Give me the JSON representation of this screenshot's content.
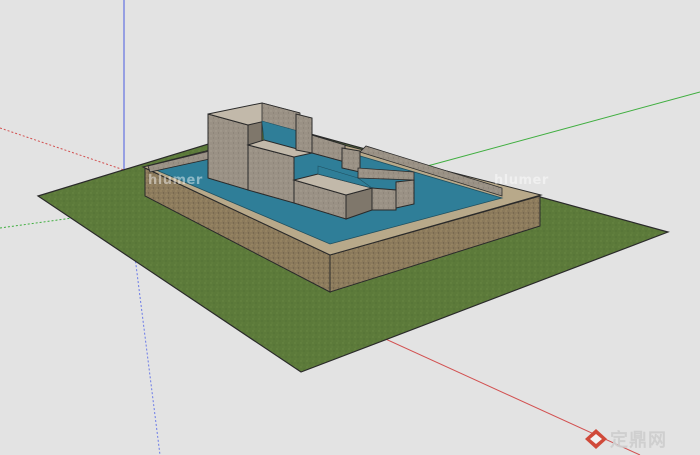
{
  "viewport": {
    "background": "#e3e3e3",
    "axes": {
      "blue": "#4a5be0",
      "red": "#d25050",
      "green": "#3fae3f"
    }
  },
  "model": {
    "grass_color": "#5c7a3a",
    "wall_color": "#8b7a5c",
    "water_color": "#2f7e98",
    "block_color": "#9a9185"
  },
  "watermarks": {
    "left": "hlumer",
    "right": "hlumer"
  },
  "logo": {
    "text": "定鼎网",
    "icon": "diamond-logo-icon",
    "color": "#d04a3a"
  }
}
